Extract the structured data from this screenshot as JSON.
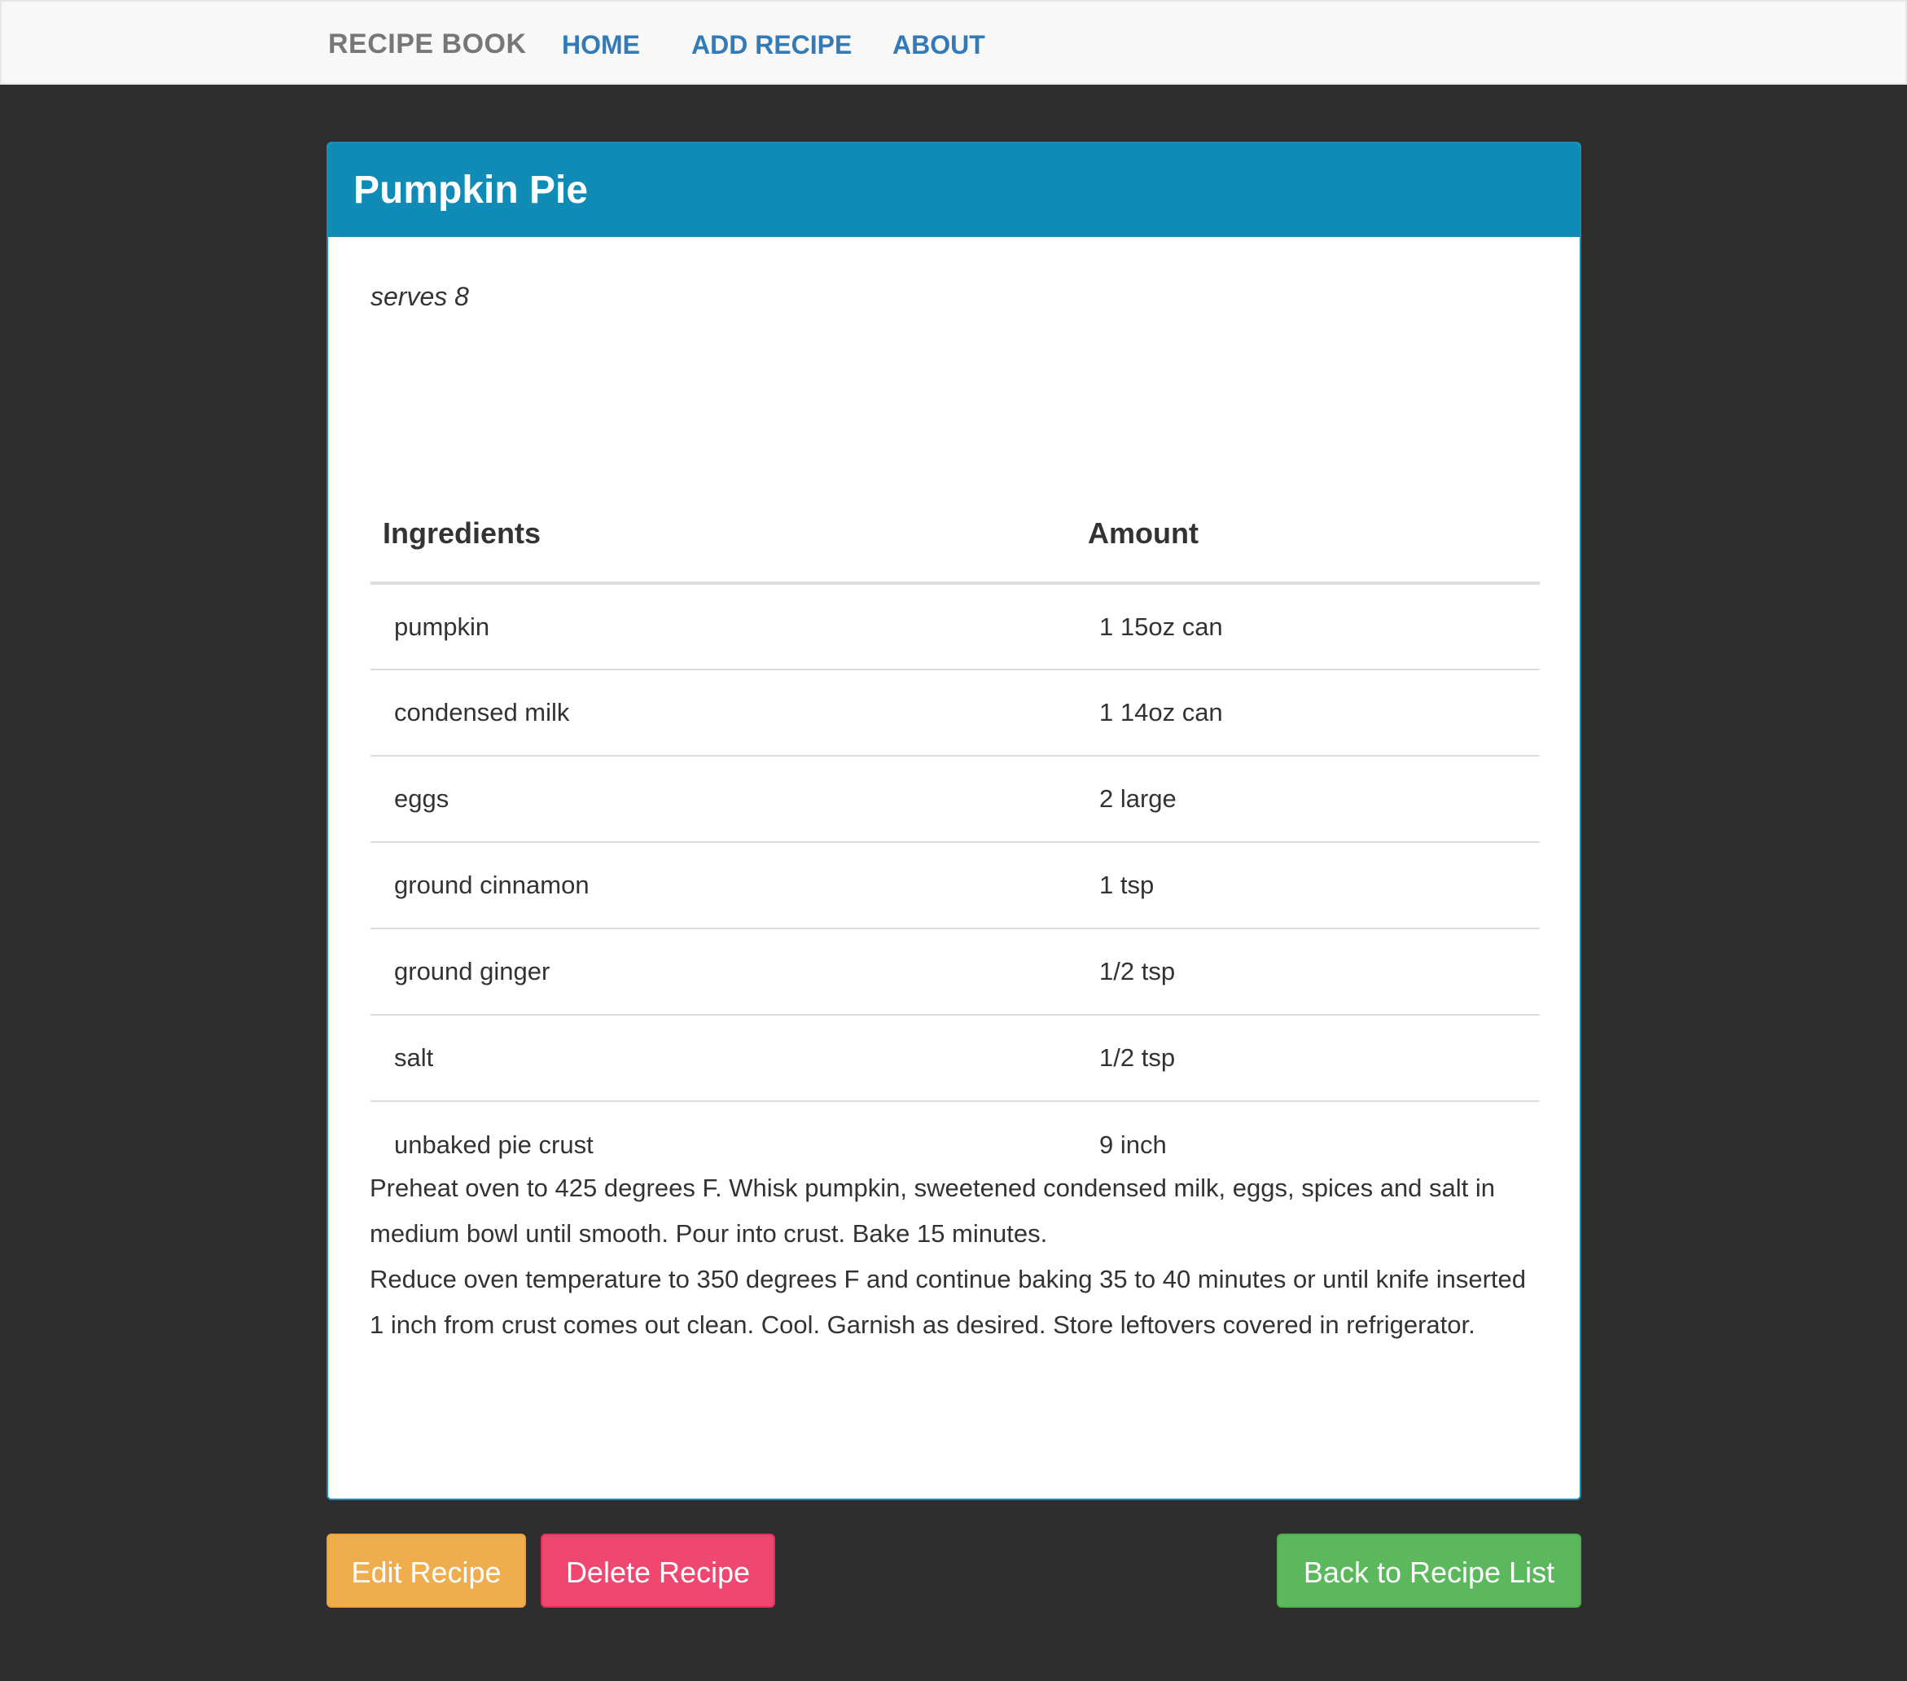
{
  "navbar": {
    "brand": "RECIPE BOOK",
    "links": [
      "HOME",
      "ADD RECIPE",
      "ABOUT"
    ]
  },
  "recipe": {
    "title": "Pumpkin Pie",
    "serves": "serves 8",
    "table_headers": [
      "Ingredients",
      "Amount"
    ],
    "ingredients": [
      {
        "name": "pumpkin",
        "amount": "1 15oz can"
      },
      {
        "name": "condensed milk",
        "amount": "1 14oz can"
      },
      {
        "name": "eggs",
        "amount": "2 large"
      },
      {
        "name": "ground cinnamon",
        "amount": "1 tsp"
      },
      {
        "name": "ground ginger",
        "amount": "1/2 tsp"
      },
      {
        "name": "salt",
        "amount": "1/2 tsp"
      },
      {
        "name": "unbaked pie crust",
        "amount": "9 inch"
      }
    ],
    "directions": [
      "Preheat oven to 425 degrees F. Whisk pumpkin, sweetened condensed milk, eggs, spices and salt in medium bowl until smooth. Pour into crust. Bake 15 minutes.",
      "Reduce oven temperature to 350 degrees F and continue baking 35 to 40 minutes or until knife inserted 1 inch from crust comes out clean. Cool. Garnish as desired. Store leftovers covered in refrigerator."
    ]
  },
  "actions": {
    "edit": "Edit Recipe",
    "delete": "Delete Recipe",
    "back": "Back to Recipe List"
  },
  "colors": {
    "background": "#2e2e2e",
    "panel_heading": "#108bb6",
    "nav_link": "#337ab7",
    "edit_button": "#f0ad4e",
    "delete_button": "#ef476f",
    "back_button": "#5cb85c"
  }
}
